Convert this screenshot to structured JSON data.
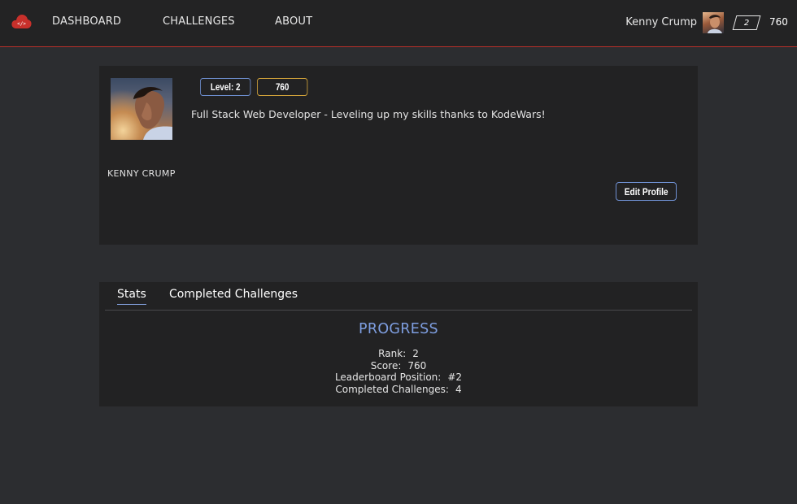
{
  "nav": {
    "links": [
      "DASHBOARD",
      "CHALLENGES",
      "ABOUT"
    ],
    "user_name": "Kenny Crump",
    "level": "2",
    "score": "760",
    "logo_icon": "cloud-code-icon",
    "accent_color": "#b8302a"
  },
  "profile": {
    "level_badge": "Level: 2",
    "score_badge": "760",
    "bio": "Full Stack Web Developer - Leveling up my skills thanks to KodeWars!",
    "display_name": "KENNY CRUMP",
    "edit_button": "Edit Profile"
  },
  "stats": {
    "tabs": [
      "Stats",
      "Completed Challenges"
    ],
    "active_tab": "Stats",
    "title": "PROGRESS",
    "rows": [
      {
        "label": "Rank:",
        "value": "2"
      },
      {
        "label": "Score:",
        "value": "760"
      },
      {
        "label": "Leaderboard Position:",
        "value": "#2"
      },
      {
        "label": "Completed Challenges:",
        "value": "4"
      }
    ]
  },
  "colors": {
    "level_border": "#6e8fd0",
    "score_border": "#d3a43a",
    "progress_title": "#7e9ee0"
  }
}
